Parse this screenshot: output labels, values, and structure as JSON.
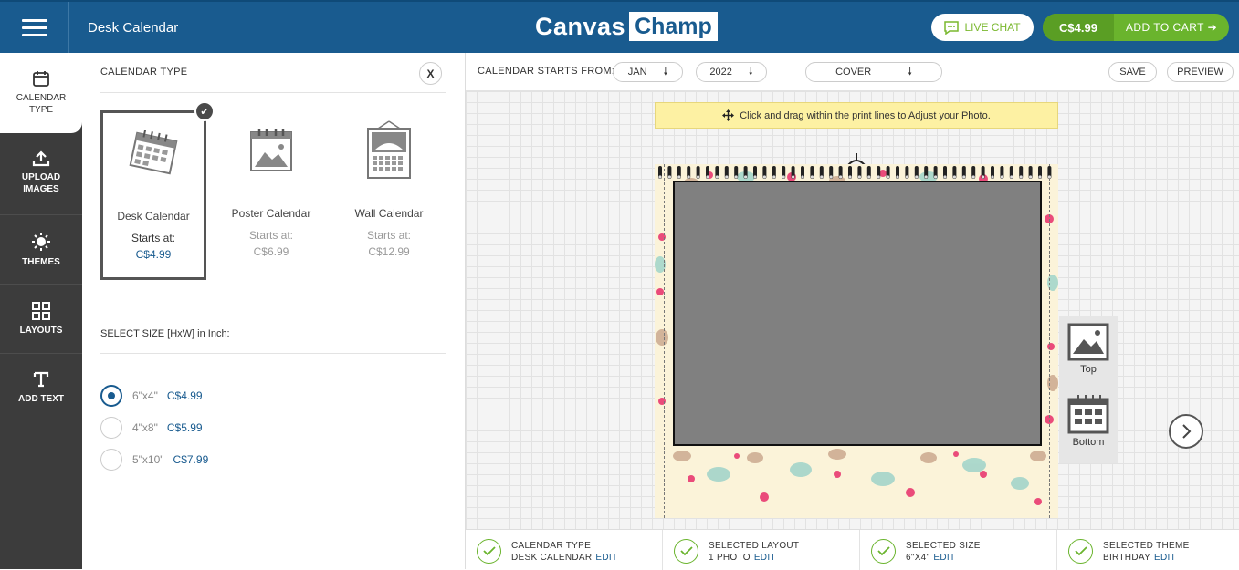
{
  "header": {
    "doc_title": "Desk Calendar",
    "logo_left": "Canvas",
    "logo_right": "Champ",
    "live_chat": "LIVE CHAT",
    "price": "C$4.99",
    "add_to_cart": "ADD TO CART ➔"
  },
  "nav": [
    {
      "label_line1": "CALENDAR",
      "label_line2": "TYPE",
      "icon": "calendar-icon",
      "active": true
    },
    {
      "label_line1": "UPLOAD",
      "label_line2": "IMAGES",
      "icon": "upload-icon"
    },
    {
      "label_line1": "THEMES",
      "label_line2": "",
      "icon": "sun-icon"
    },
    {
      "label_line1": "LAYOUTS",
      "label_line2": "",
      "icon": "grid-icon"
    },
    {
      "label_line1": "ADD TEXT",
      "label_line2": "",
      "icon": "text-icon"
    }
  ],
  "panel": {
    "title": "CALENDAR TYPE",
    "close": "X",
    "types": [
      {
        "name": "Desk Calendar",
        "starts": "Starts at:",
        "price": "C$4.99",
        "selected": true
      },
      {
        "name": "Poster Calendar",
        "starts": "Starts at:",
        "price": "C$6.99"
      },
      {
        "name": "Wall Calendar",
        "starts": "Starts at:",
        "price": "C$12.99"
      }
    ],
    "size_title": "SELECT SIZE [HxW] in Inch:",
    "sizes": [
      {
        "dim": "6\"x4\"",
        "price": "C$4.99",
        "selected": true
      },
      {
        "dim": "4\"x8\"",
        "price": "C$5.99"
      },
      {
        "dim": "5\"x10\"",
        "price": "C$7.99"
      }
    ]
  },
  "toolbar": {
    "starts_label": "CALENDAR STARTS FROM:",
    "month": "JAN",
    "year": "2022",
    "page": "COVER",
    "save": "SAVE",
    "preview": "PREVIEW"
  },
  "canvas": {
    "hint": "Click and drag within the print lines to Adjust your Photo.",
    "top_btn": "Top",
    "bottom_btn": "Bottom"
  },
  "status": [
    {
      "title": "CALENDAR TYPE",
      "value": "DESK CALENDAR",
      "edit": "EDIT"
    },
    {
      "title": "SELECTED LAYOUT",
      "value": "1 PHOTO",
      "edit": "EDIT"
    },
    {
      "title": "SELECTED SIZE",
      "value": "6\"X4\"",
      "edit": "EDIT"
    },
    {
      "title": "SELECTED THEME",
      "value": "BIRTHDAY",
      "edit": "EDIT"
    }
  ],
  "colors": {
    "brand": "#195b8f",
    "accent": "#6ab42d",
    "sidebar": "#3c3c3c"
  }
}
